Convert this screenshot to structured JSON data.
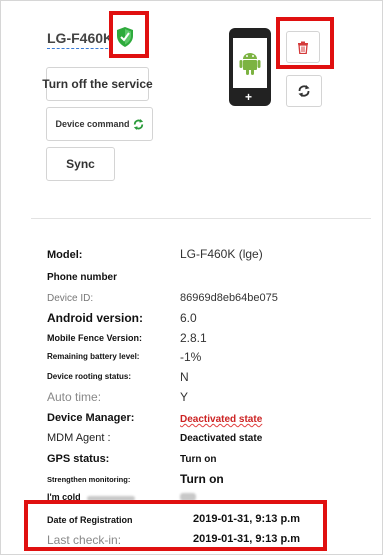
{
  "device": {
    "name": "LG-F460K"
  },
  "buttons": {
    "turn_off": "Turn off the service",
    "device_command": "Device command",
    "sync": "Sync"
  },
  "icons": {
    "shield": "shield-check-icon",
    "trash": "trash-icon",
    "refresh": "refresh-icon",
    "android": "android-icon",
    "command": "refresh-arrows-icon"
  },
  "colors": {
    "highlight_box": "#e01010",
    "shield_green": "#2eaa3c",
    "android_green": "#7cb342",
    "deactivated_red": "#cc2222",
    "link_blue": "#3a7bd5"
  },
  "info": {
    "model_label": "Model:",
    "model_value": "LG-F460K (lge)",
    "phone_label": "Phone number",
    "device_id_label": "Device ID:",
    "device_id_value": "86969d8eb64be075",
    "android_label": "Android version:",
    "android_value": "6.0",
    "fence_label": "Mobile Fence Version:",
    "fence_value": "2.8.1",
    "battery_label": "Remaining battery level:",
    "battery_value": "-1%",
    "rooting_label": "Device rooting status:",
    "rooting_value": "N",
    "autotime_label": "Auto time:",
    "autotime_value": "Y",
    "manager_label": "Device Manager:",
    "manager_value": "Deactivated state",
    "mdm_label": "MDM Agent :",
    "mdm_value": "Deactivated state",
    "gps_label": "GPS status:",
    "gps_value": "Turn on",
    "strengthen_label": "Strengthen monitoring:",
    "strengthen_value": "Turn on",
    "cold_label": "I'm cold",
    "registration_label": "Date of Registration",
    "registration_value": "2019-01-31, 9:13 p.m",
    "lastcheck_label": "Last check-in:",
    "lastcheck_value": "2019-01-31, 9:13 p.m"
  }
}
